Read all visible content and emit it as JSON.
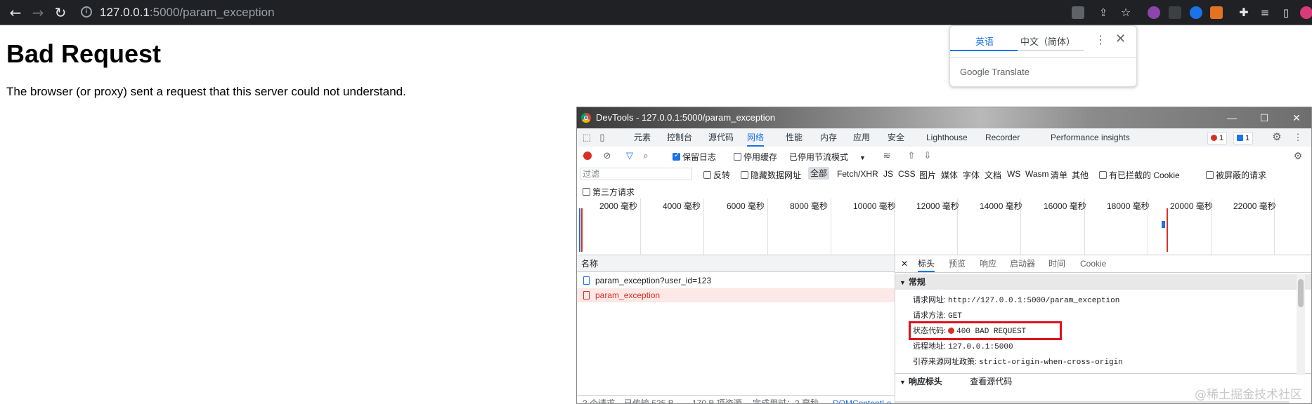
{
  "browser": {
    "url_host": "127.0.0.1",
    "url_rest": ":5000/param_exception"
  },
  "page": {
    "title": "Bad Request",
    "message": "The browser (or proxy) sent a request that this server could not understand."
  },
  "translate_popup": {
    "tab_english": "英语",
    "tab_chinese": "中文（简体）",
    "brand": "Google Translate"
  },
  "devtools": {
    "window_title": "DevTools - 127.0.0.1:5000/param_exception",
    "tabs": [
      "元素",
      "控制台",
      "源代码",
      "网络",
      "性能",
      "内存",
      "应用",
      "安全",
      "Lighthouse",
      "Recorder",
      "Performance insights"
    ],
    "active_tab": "网络",
    "error_count": "1",
    "message_count": "1",
    "toolbar": {
      "preserve_log": "保留日志",
      "disable_cache": "停用缓存",
      "throttling": "已停用节流模式"
    },
    "filter": {
      "placeholder": "过滤",
      "invert": "反转",
      "hide_data_urls": "隐藏数据网址",
      "all": "全部",
      "types": [
        "Fetch/XHR",
        "JS",
        "CSS",
        "图片",
        "媒体",
        "字体",
        "文档",
        "WS",
        "Wasm",
        "清单",
        "其他"
      ],
      "blocked_cookies": "有已拦截的 Cookie",
      "blocked_requests": "被屏蔽的请求",
      "third_party": "第三方请求"
    },
    "timeline_ticks": [
      "2000 毫秒",
      "4000 毫秒",
      "6000 毫秒",
      "8000 毫秒",
      "10000 毫秒",
      "12000 毫秒",
      "14000 毫秒",
      "16000 毫秒",
      "18000 毫秒",
      "20000 毫秒",
      "22000 毫秒",
      "24"
    ],
    "names_header": "名称",
    "requests": [
      {
        "name": "param_exception?user_id=123",
        "error": false
      },
      {
        "name": "param_exception",
        "error": true
      }
    ],
    "status_bar": {
      "requests": "2 个请求",
      "transferred": "已传输 525 B",
      "resources": "170 B 项资源",
      "finish": "完成用时：2 毫秒",
      "dom": "DOMContentLo"
    },
    "detail_tabs": [
      "标头",
      "预览",
      "响应",
      "启动器",
      "时间",
      "Cookie"
    ],
    "active_detail_tab": "标头",
    "general_title": "常规",
    "general": {
      "request_url_k": "请求网址:",
      "request_url_v": "http://127.0.0.1:5000/param_exception",
      "method_k": "请求方法:",
      "method_v": "GET",
      "status_k": "状态代码:",
      "status_v": "400 BAD REQUEST",
      "remote_k": "远程地址:",
      "remote_v": "127.0.0.1:5000",
      "referrer_k": "引荐来源网址政策:",
      "referrer_v": "strict-origin-when-cross-origin"
    },
    "response_headers_title": "响应标头",
    "view_source": "查看源代码"
  },
  "watermark": "@稀土掘金技术社区",
  "colors": {
    "accent": "#1a73e8",
    "error": "#d93025",
    "highlight_box": "#e0101a"
  }
}
